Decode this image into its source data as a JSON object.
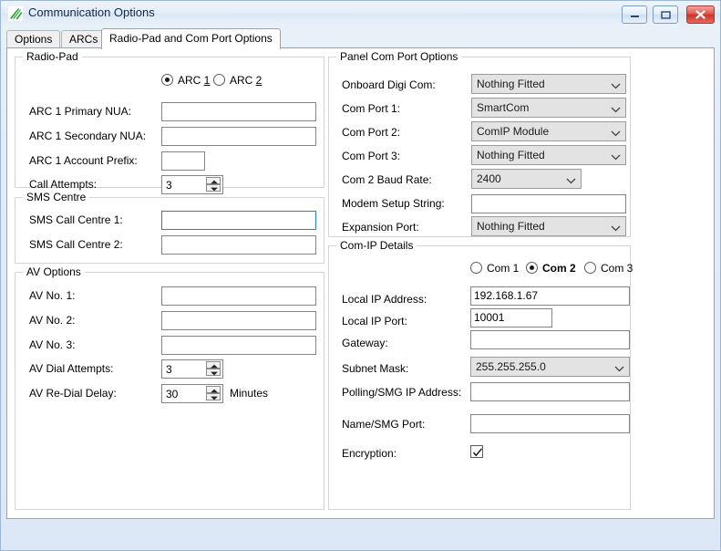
{
  "window": {
    "title": "Communication Options",
    "icon": "app-leaf-icon",
    "buttons": {
      "minimize": "minimize-icon",
      "maximize": "maximize-icon",
      "close": "close-icon"
    }
  },
  "tabs": [
    {
      "label": "Options",
      "active": false
    },
    {
      "label": "ARCs",
      "active": false
    },
    {
      "label": "Radio-Pad and Com Port Options",
      "active": true
    }
  ],
  "radiopad": {
    "legend": "Radio-Pad",
    "arc_radios": [
      {
        "label_pre": "ARC ",
        "accel": "1",
        "checked": true
      },
      {
        "label_pre": "ARC ",
        "accel": "2",
        "checked": false
      }
    ],
    "fields": [
      {
        "label": "ARC 1 Primary NUA:",
        "value": ""
      },
      {
        "label": "ARC 1 Secondary NUA:",
        "value": ""
      },
      {
        "label": "ARC 1 Account Prefix:",
        "value": ""
      }
    ],
    "call_attempts": {
      "label": "Call Attempts:",
      "value": "3"
    }
  },
  "sms": {
    "legend": "SMS Centre",
    "fields": [
      {
        "label": "SMS Call Centre 1:",
        "value": "",
        "focused": true
      },
      {
        "label": "SMS Call Centre 2:",
        "value": "",
        "focused": false
      }
    ]
  },
  "av": {
    "legend": "AV Options",
    "fields": [
      {
        "label": "AV No. 1:",
        "value": ""
      },
      {
        "label": "AV No. 2:",
        "value": ""
      },
      {
        "label": "AV No. 3:",
        "value": ""
      }
    ],
    "dial_attempts": {
      "label": "AV Dial Attempts:",
      "value": "3"
    },
    "redial_delay": {
      "label": "AV Re-Dial Delay:",
      "value": "30",
      "unit": "Minutes"
    }
  },
  "panelcom": {
    "legend": "Panel Com Port Options",
    "rows": [
      {
        "label": "Onboard Digi Com:",
        "value": "Nothing Fitted",
        "kind": "combo"
      },
      {
        "label": "Com Port 1:",
        "value": "SmartCom",
        "kind": "combo"
      },
      {
        "label": "Com Port 2:",
        "value": "ComIP Module",
        "kind": "combo"
      },
      {
        "label": "Com Port 3:",
        "value": "Nothing Fitted",
        "kind": "combo"
      },
      {
        "label": "Com 2 Baud Rate:",
        "value": "2400",
        "kind": "combo-narrow"
      },
      {
        "label": "Modem Setup String:",
        "value": "",
        "kind": "text"
      },
      {
        "label": "Expansion Port:",
        "value": "Nothing Fitted",
        "kind": "combo"
      }
    ]
  },
  "comip": {
    "legend": "Com-IP Details",
    "com_radios": [
      {
        "label": "Com 1",
        "checked": false
      },
      {
        "label": "Com 2",
        "checked": true
      },
      {
        "label": "Com 3",
        "checked": false
      }
    ],
    "rows": [
      {
        "label": "Local IP Address:",
        "value": "192.168.1.67",
        "kind": "text"
      },
      {
        "label": "Local IP Port:",
        "value": "10001",
        "kind": "text-narrow"
      },
      {
        "label": "Gateway:",
        "value": "",
        "kind": "text"
      },
      {
        "label": "Subnet Mask:",
        "value": "255.255.255.0",
        "kind": "combo"
      },
      {
        "label": "Polling/SMG IP Address:",
        "value": "",
        "kind": "text"
      },
      {
        "label": "Name/SMG Port:",
        "value": "",
        "kind": "text"
      }
    ],
    "encryption": {
      "label": "Encryption:",
      "checked": true,
      "icon": "checkmark-icon"
    }
  },
  "colors": {
    "window_border": "#9cb8d4",
    "titlebar": "#e4edf8",
    "close_button": "#cf3327",
    "focus_border": "#2b7ec1",
    "combo_background": "#e3e3e3",
    "group_border": "#d4d4d4",
    "page_background": "#ffffff"
  }
}
